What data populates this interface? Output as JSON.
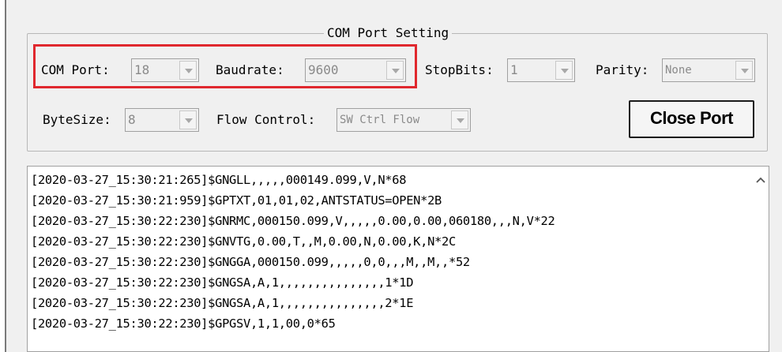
{
  "group": {
    "title": "COM Port Setting"
  },
  "fields": {
    "com_port": {
      "label": "COM Port:",
      "value": "18"
    },
    "baudrate": {
      "label": "Baudrate:",
      "value": "9600"
    },
    "stopbits": {
      "label": "StopBits:",
      "value": "1"
    },
    "parity": {
      "label": "Parity:",
      "value": "None"
    },
    "bytesize": {
      "label": "ByteSize:",
      "value": "8"
    },
    "flow_control": {
      "label": "Flow Control:",
      "value": "SW Ctrl Flow"
    }
  },
  "close_button": {
    "label": "Close Port"
  },
  "log": {
    "lines": [
      "[2020-03-27_15:30:21:265]$GNGLL,,,,,000149.099,V,N*68",
      "[2020-03-27_15:30:21:959]$GPTXT,01,01,02,ANTSTATUS=OPEN*2B",
      "[2020-03-27_15:30:22:230]$GNRMC,000150.099,V,,,,,0.00,0.00,060180,,,N,V*22",
      "[2020-03-27_15:30:22:230]$GNVTG,0.00,T,,M,0.00,N,0.00,K,N*2C",
      "[2020-03-27_15:30:22:230]$GNGGA,000150.099,,,,,0,0,,,M,,M,,*52",
      "[2020-03-27_15:30:22:230]$GNGSA,A,1,,,,,,,,,,,,,,,1*1D",
      "[2020-03-27_15:30:22:230]$GNGSA,A,1,,,,,,,,,,,,,,,2*1E",
      "[2020-03-27_15:30:22:230]$GPGSV,1,1,00,0*65"
    ]
  },
  "icons": {
    "scroll_up": "chevron-up-icon",
    "dropdown": "chevron-down-icon"
  },
  "colors": {
    "highlight": "#e0282e",
    "disabled_text": "#8a8a8a"
  }
}
